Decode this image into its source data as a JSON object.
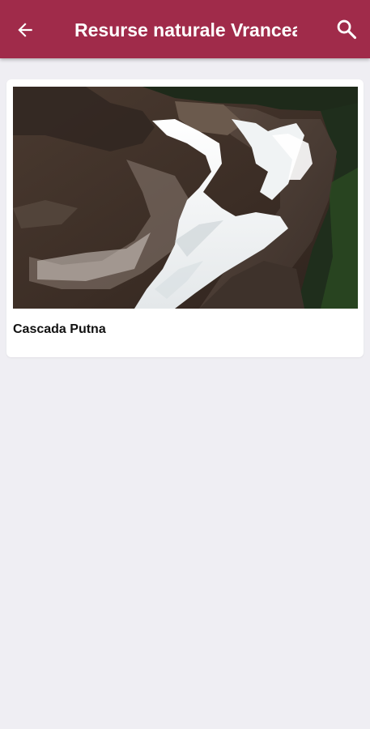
{
  "app_bar": {
    "title": "Resurse naturale Vrancea",
    "back_icon": "arrow-left-icon",
    "search_icon": "search-icon",
    "color": "#a02b4a"
  },
  "list": {
    "items": [
      {
        "title": "Cascada Putna",
        "image": "waterfall-photo"
      }
    ]
  }
}
